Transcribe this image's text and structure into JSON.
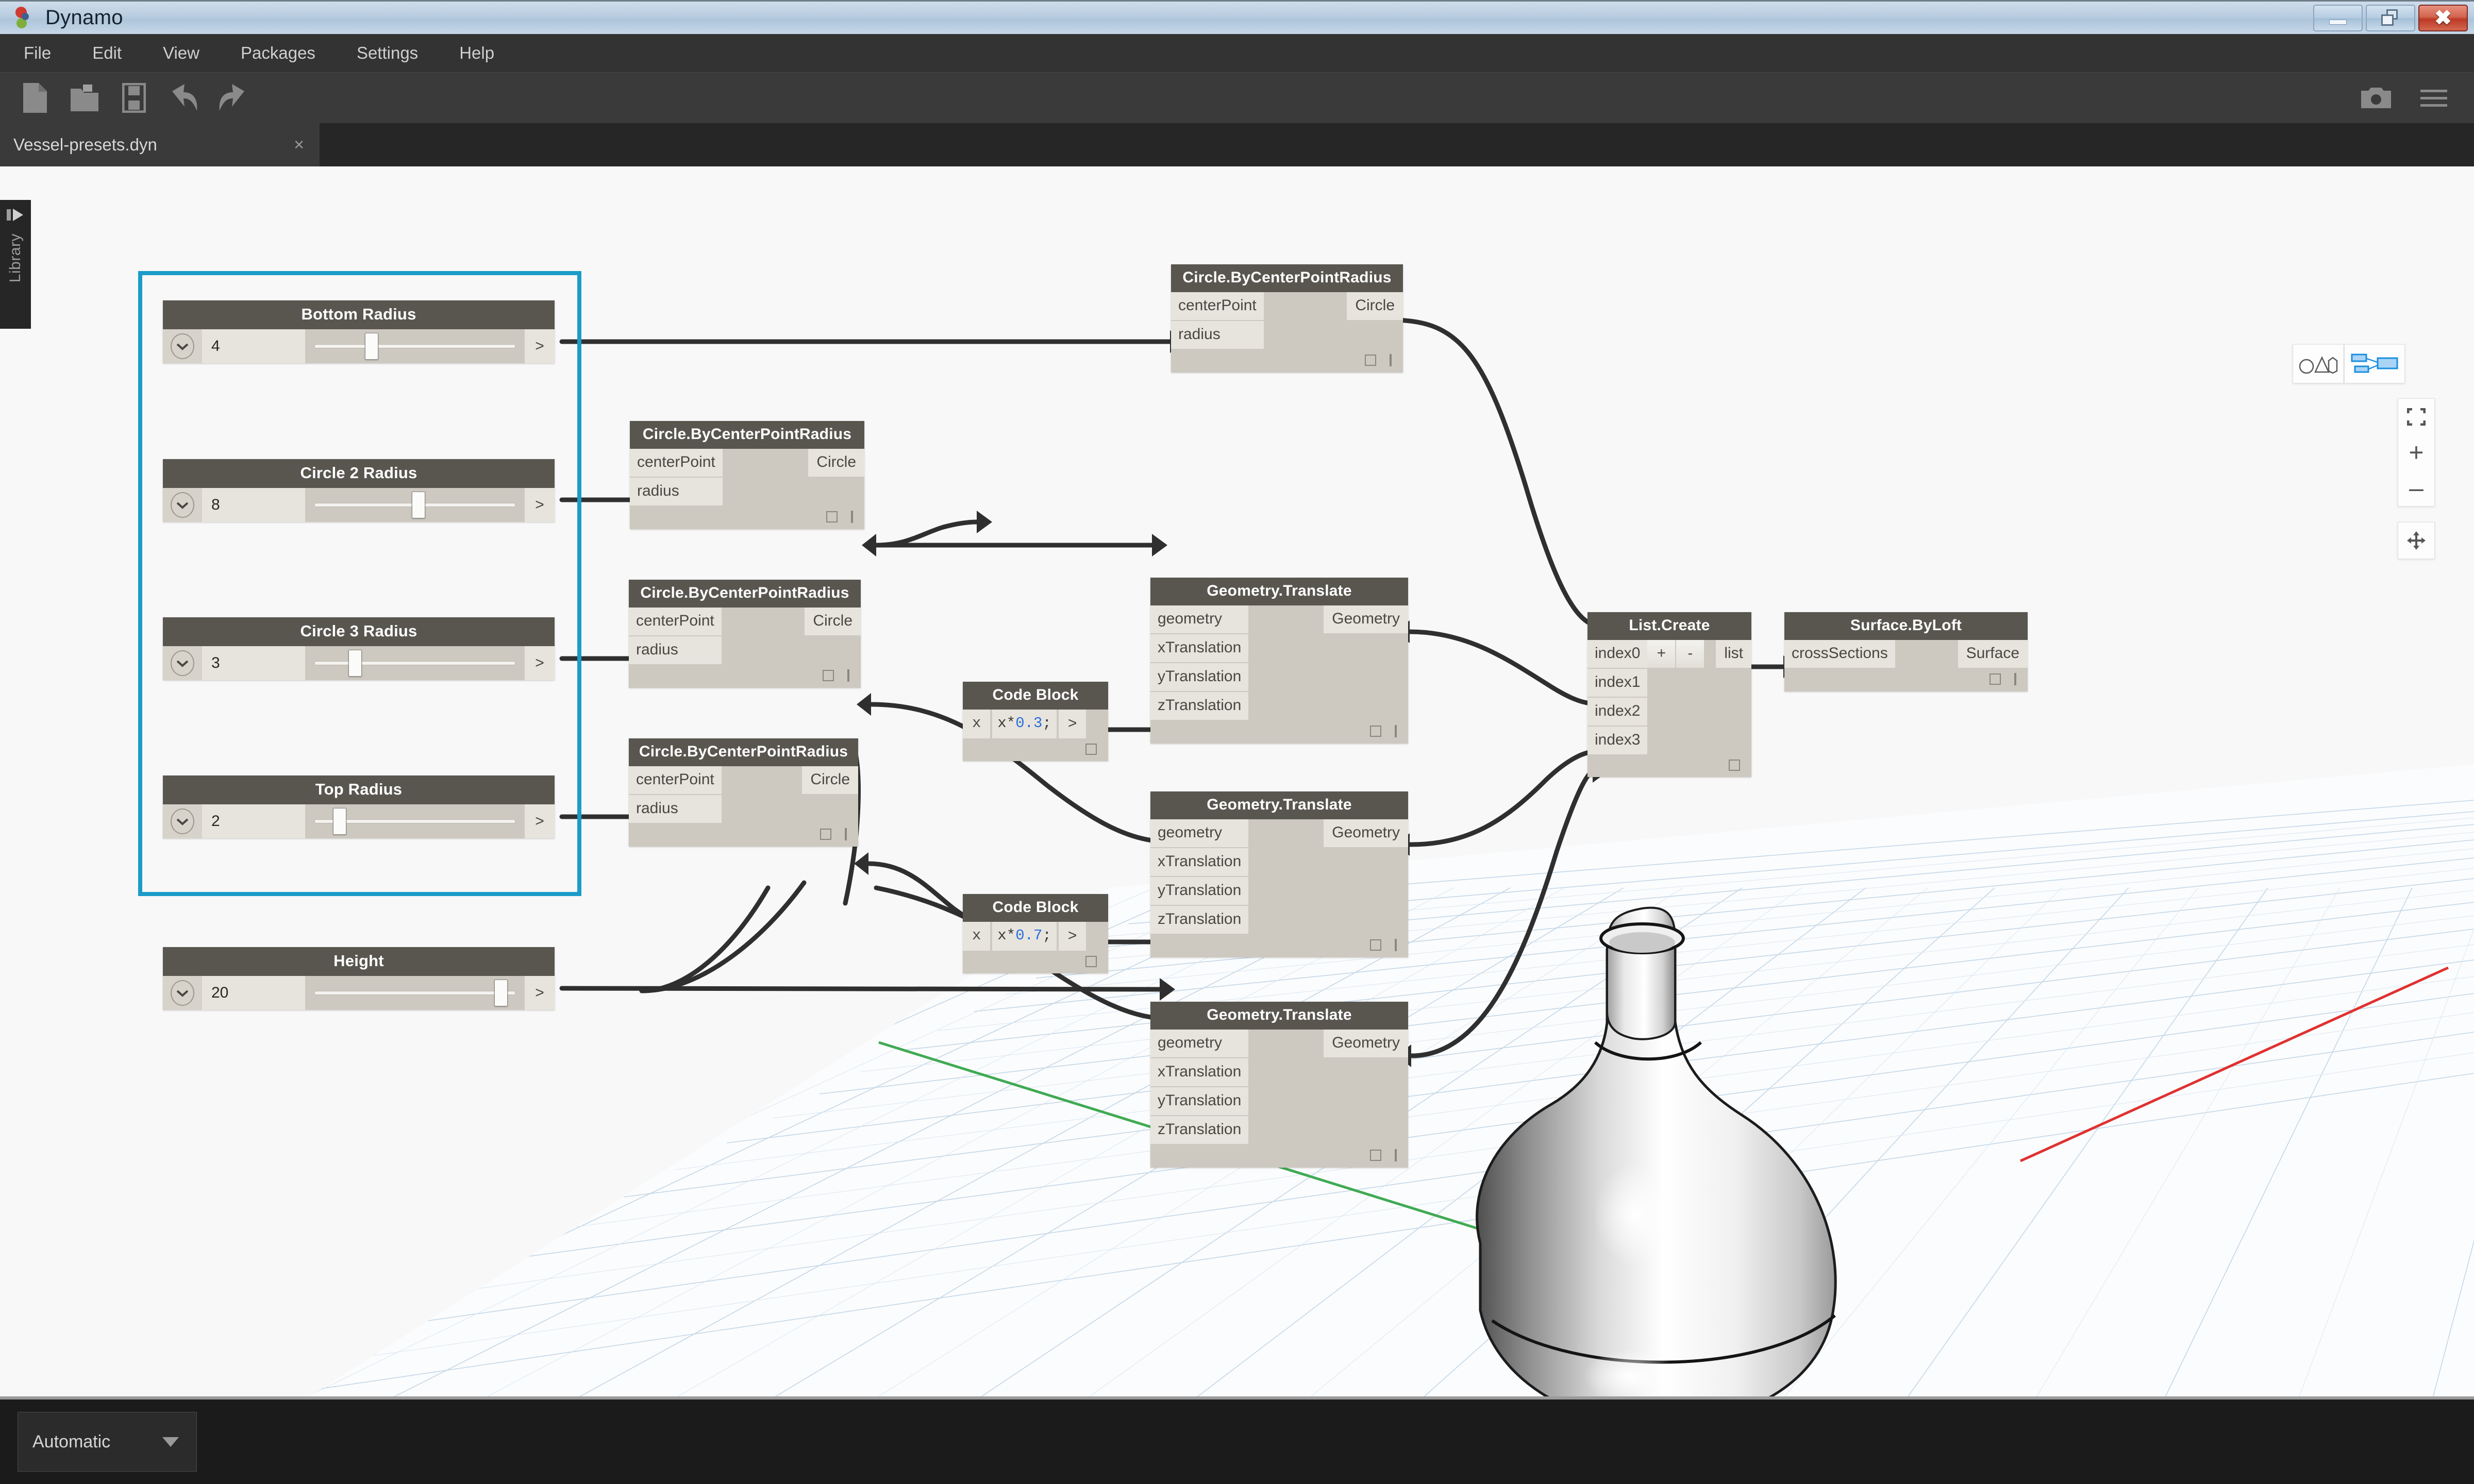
{
  "window": {
    "title": "Dynamo",
    "minimize_label": "Minimize",
    "maximize_label": "Restore",
    "close_label": "Close"
  },
  "menu": {
    "items": [
      "File",
      "Edit",
      "View",
      "Packages",
      "Settings",
      "Help"
    ]
  },
  "toolbar": {
    "buttons": [
      "new-file-icon",
      "open-folder-icon",
      "save-icon",
      "undo-icon",
      "redo-icon"
    ],
    "camera_label": "screenshot-icon",
    "menu_label": "hamburger-icon"
  },
  "tab": {
    "label": "Vessel-presets.dyn",
    "close": "×"
  },
  "library": {
    "label": "Library"
  },
  "status": {
    "run_mode": "Automatic"
  },
  "viewport_controls": {
    "geometry_view_label": "geometry-view-icon",
    "graph_view_label": "graph-view-icon",
    "zoom_fit_label": "zoom-to-fit-icon",
    "zoom_in_label": "+",
    "zoom_out_label": "–",
    "pan_label": "pan-icon"
  },
  "sliders": [
    {
      "title": "Bottom Radius",
      "value": "4",
      "fill": 0.27,
      "caret": "˅",
      "out": ">"
    },
    {
      "title": "Circle 2 Radius",
      "value": "8",
      "fill": 0.52,
      "caret": "˅",
      "out": ">"
    },
    {
      "title": "Circle 3 Radius",
      "value": "3",
      "fill": 0.18,
      "caret": "˅",
      "out": ">"
    },
    {
      "title": "Top Radius",
      "value": "2",
      "fill": 0.1,
      "caret": "˅",
      "out": ">"
    },
    {
      "title": "Height",
      "value": "20",
      "fill": 0.96,
      "caret": "˅",
      "out": ">"
    }
  ],
  "nodes": {
    "circle_top": {
      "title": "Circle.ByCenterPointRadius",
      "inputs": [
        "centerPoint",
        "radius"
      ],
      "outputs": [
        "Circle"
      ]
    },
    "circle_2": {
      "title": "Circle.ByCenterPointRadius",
      "inputs": [
        "centerPoint",
        "radius"
      ],
      "outputs": [
        "Circle"
      ]
    },
    "circle_3": {
      "title": "Circle.ByCenterPointRadius",
      "inputs": [
        "centerPoint",
        "radius"
      ],
      "outputs": [
        "Circle"
      ]
    },
    "circle_4": {
      "title": "Circle.ByCenterPointRadius",
      "inputs": [
        "centerPoint",
        "radius"
      ],
      "outputs": [
        "Circle"
      ]
    },
    "codeblock_1": {
      "title": "Code Block",
      "input": "x",
      "code_var": "x*",
      "code_num": "0.3",
      "code_end": ";",
      "output": ">"
    },
    "codeblock_2": {
      "title": "Code Block",
      "input": "x",
      "code_var": "x*",
      "code_num": "0.7",
      "code_end": ";",
      "output": ">"
    },
    "translate_1": {
      "title": "Geometry.Translate",
      "inputs": [
        "geometry",
        "xTranslation",
        "yTranslation",
        "zTranslation"
      ],
      "outputs": [
        "Geometry"
      ]
    },
    "translate_2": {
      "title": "Geometry.Translate",
      "inputs": [
        "geometry",
        "xTranslation",
        "yTranslation",
        "zTranslation"
      ],
      "outputs": [
        "Geometry"
      ]
    },
    "translate_3": {
      "title": "Geometry.Translate",
      "inputs": [
        "geometry",
        "xTranslation",
        "yTranslation",
        "zTranslation"
      ],
      "outputs": [
        "Geometry"
      ]
    },
    "list_create": {
      "title": "List.Create",
      "inputs": [
        "index0",
        "index1",
        "index2",
        "index3"
      ],
      "outputs": [
        "list"
      ],
      "add_button": "+",
      "remove_button": "-"
    },
    "surface_byloft": {
      "title": "Surface.ByLoft",
      "inputs": [
        "crossSections"
      ],
      "outputs": [
        "Surface"
      ]
    }
  },
  "colors": {
    "accent_selection": "#1a9cc8",
    "node_header": "#58564f",
    "node_body": "#cdc9c1",
    "node_port": "#e7e4de",
    "wire": "#2f2f2f",
    "canvas_bg": "#f8f8f8",
    "axis_x_red": "#e03131",
    "axis_y_green": "#3faa53",
    "grid_blue": "#b9cfe4"
  }
}
